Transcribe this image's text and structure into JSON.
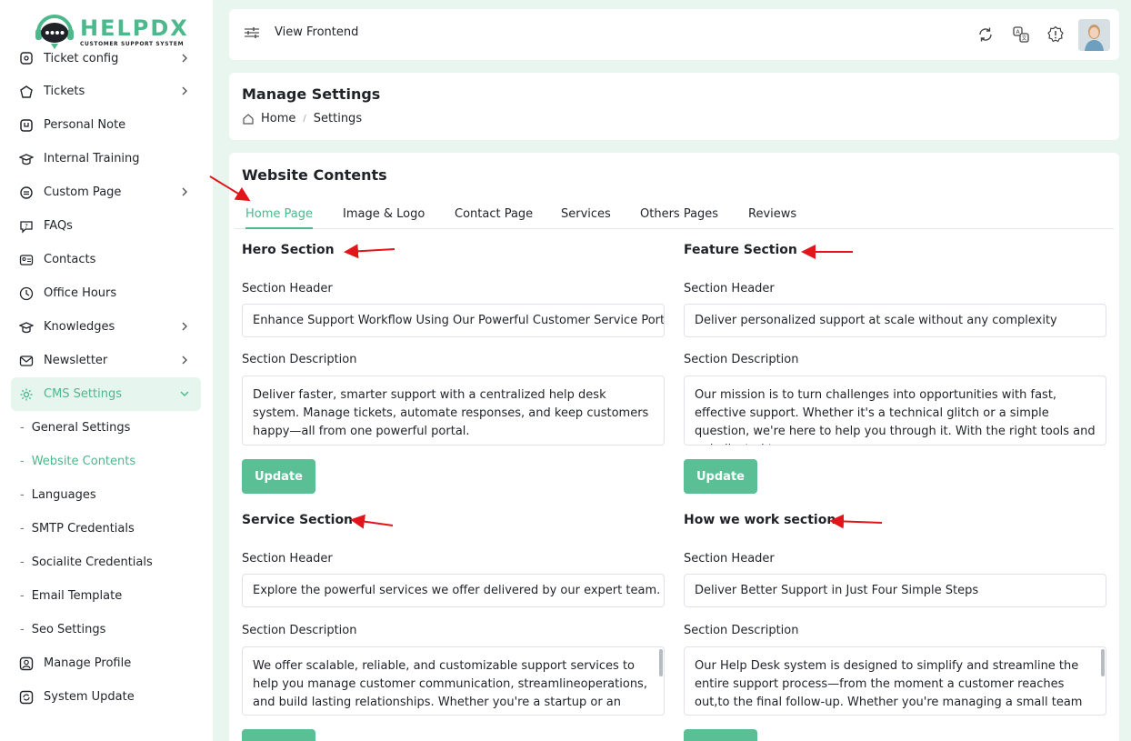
{
  "app": {
    "logo_title": "HELPDX",
    "logo_subtitle": "CUSTOMER SUPPORT SYSTEM"
  },
  "sidebar": {
    "items": [
      {
        "label": "Ticket config",
        "icon": "ticket-config-icon",
        "has_chevron": true
      },
      {
        "label": "Tickets",
        "icon": "tickets-icon",
        "has_chevron": true
      },
      {
        "label": "Personal Note",
        "icon": "note-icon",
        "has_chevron": false
      },
      {
        "label": "Internal Training",
        "icon": "training-icon",
        "has_chevron": false
      },
      {
        "label": "Custom Page",
        "icon": "page-icon",
        "has_chevron": true
      },
      {
        "label": "FAQs",
        "icon": "faq-icon",
        "has_chevron": false
      },
      {
        "label": "Contacts",
        "icon": "contacts-icon",
        "has_chevron": false
      },
      {
        "label": "Office Hours",
        "icon": "clock-icon",
        "has_chevron": false
      },
      {
        "label": "Knowledges",
        "icon": "knowledge-icon",
        "has_chevron": true
      },
      {
        "label": "Newsletter",
        "icon": "newsletter-icon",
        "has_chevron": true
      },
      {
        "label": "CMS Settings",
        "icon": "gear-icon",
        "has_chevron": true
      }
    ],
    "sub_items": [
      {
        "label": "General Settings"
      },
      {
        "label": "Website Contents"
      },
      {
        "label": "Languages"
      },
      {
        "label": "SMTP Credentials"
      },
      {
        "label": "Socialite Credentials"
      },
      {
        "label": "Email Template"
      },
      {
        "label": "Seo Settings"
      }
    ],
    "bottom_items": [
      {
        "label": "Manage Profile",
        "icon": "profile-icon"
      },
      {
        "label": "System Update",
        "icon": "update-icon"
      }
    ],
    "accent": "#4cb88c"
  },
  "topbar": {
    "view_frontend": "View Frontend"
  },
  "header": {
    "title": "Manage Settings",
    "breadcrumb_home": "Home",
    "breadcrumb_current": "Settings"
  },
  "main": {
    "title": "Website Contents",
    "tabs": [
      {
        "label": "Home Page"
      },
      {
        "label": "Image & Logo"
      },
      {
        "label": "Contact Page"
      },
      {
        "label": "Services"
      },
      {
        "label": "Others Pages"
      },
      {
        "label": "Reviews"
      }
    ],
    "sections": [
      {
        "title": "Hero Section",
        "header_label": "Section Header",
        "header_value": "Enhance Support Workflow Using Our Powerful Customer Service Portal",
        "description_label": "Section Description",
        "description_value": "Deliver faster, smarter support with a centralized help desk system. Manage tickets, automate responses, and keep customers happy—all from one powerful portal.",
        "button": "Update"
      },
      {
        "title": "Feature Section",
        "header_label": "Section Header",
        "header_value": "Deliver personalized support at scale without any complexity",
        "description_label": "Section Description",
        "description_value": "Our mission is to turn challenges into opportunities with fast, effective support. Whether it's a technical glitch or a simple question, we're here to help you through it. With the right tools and a dedicated team.",
        "button": "Update"
      },
      {
        "title": "Service Section",
        "header_label": "Section Header",
        "header_value": "Explore the powerful services we offer delivered by our expert team.",
        "description_label": "Section Description",
        "description_value": "We offer scalable, reliable, and customizable support services to help you manage customer communication, streamlineoperations, and build lasting relationships. Whether you're a startup or an enterprise, our"
      },
      {
        "title": "How we work section",
        "header_label": "Section Header",
        "header_value": "Deliver Better Support in Just Four Simple Steps",
        "description_label": "Section Description",
        "description_value": "Our Help Desk system is designed to simplify and streamline the entire support process—from the moment a customer reaches out,to the final follow-up. Whether you're managing a small team or scaling across"
      }
    ]
  },
  "colors": {
    "accent": "#4cb88c",
    "button": "#5bbf96",
    "annotation": "#e0161b",
    "page_bg": "#e9f5ef"
  }
}
